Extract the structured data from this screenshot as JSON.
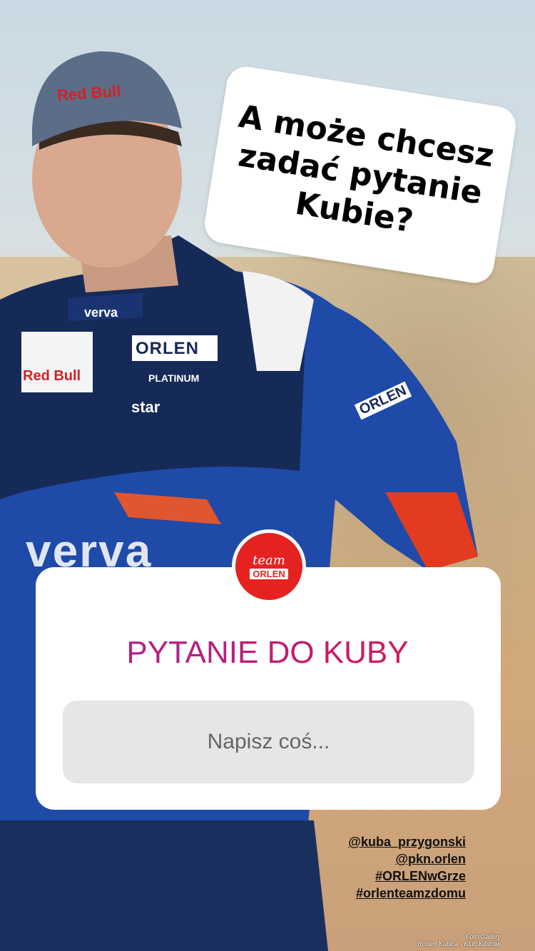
{
  "sticker": {
    "lines": [
      "A może chcesz",
      "zadać pytanie",
      "Kubie?"
    ]
  },
  "suit_logos": {
    "cap": "Red Bull",
    "chest_left": "Red Bull",
    "chest_center": "ORLEN",
    "platinum": "PLATINUM",
    "star": "star",
    "collar": "verva",
    "belly": "verva",
    "sleeve": "ORLEN"
  },
  "question_card": {
    "avatar_team": "team",
    "avatar_brand": "ORLEN",
    "title": "PYTANIE DO KUBY",
    "input_placeholder": "Napisz coś..."
  },
  "tags": [
    "@kuba_przygonski",
    "@pkn.orlen",
    "#ORLENwGrze",
    "#orlenteamzdomu"
  ],
  "credit": {
    "line1": "Foto Gallery",
    "line2": "Robert Kubica - Klub Kibiców"
  },
  "colors": {
    "title_gradient_start": "#9b2aa0",
    "title_gradient_end": "#d71f3d",
    "suit_blue": "#1f4aa8",
    "suit_navy": "#162a57",
    "accent_red": "#e42320"
  }
}
